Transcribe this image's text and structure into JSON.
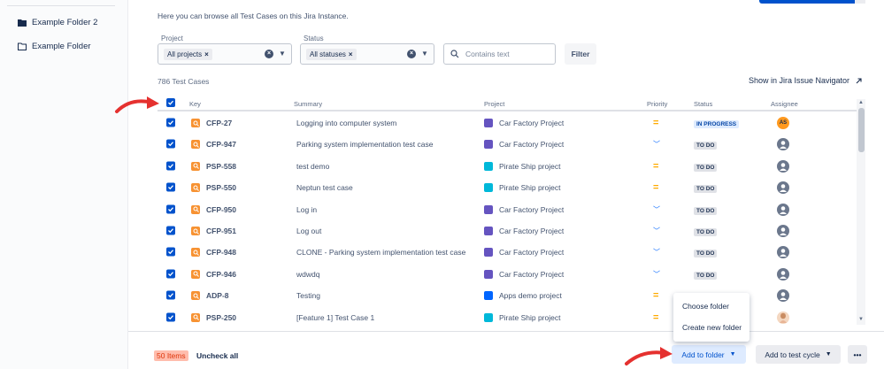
{
  "sidebar": {
    "folders": [
      {
        "label": "Example Folder 2",
        "icon": "folder-filled-icon"
      },
      {
        "label": "Example Folder",
        "icon": "folder-outline-icon"
      }
    ]
  },
  "intro": "Here you can browse all Test Cases on this Jira Instance.",
  "filters": {
    "project_label": "Project",
    "project_value": "All projects",
    "status_label": "Status",
    "status_value": "All statuses",
    "search_placeholder": "Contains text",
    "filter_button": "Filter"
  },
  "count_text": "786 Test Cases",
  "navigator_link": "Show in Jira Issue Navigator",
  "table": {
    "columns": [
      "Key",
      "Summary",
      "Project",
      "Priority",
      "Status",
      "Assignee"
    ],
    "rows": [
      {
        "key": "CFP-27",
        "summary": "Logging into computer system",
        "project": "Car Factory Project",
        "project_color": "#6554c0",
        "priority": "medium",
        "status": "IN PROGRESS",
        "assignee": "AS"
      },
      {
        "key": "CFP-947",
        "summary": "Parking system implementation test case",
        "project": "Car Factory Project",
        "project_color": "#6554c0",
        "priority": "low",
        "status": "TO DO",
        "assignee": ""
      },
      {
        "key": "PSP-558",
        "summary": "test demo",
        "project": "Pirate Ship project",
        "project_color": "#00b8d9",
        "priority": "medium",
        "status": "TO DO",
        "assignee": ""
      },
      {
        "key": "PSP-550",
        "summary": "Neptun test case",
        "project": "Pirate Ship project",
        "project_color": "#00b8d9",
        "priority": "medium",
        "status": "TO DO",
        "assignee": ""
      },
      {
        "key": "CFP-950",
        "summary": "Log in",
        "project": "Car Factory Project",
        "project_color": "#6554c0",
        "priority": "low",
        "status": "TO DO",
        "assignee": ""
      },
      {
        "key": "CFP-951",
        "summary": "Log out",
        "project": "Car Factory Project",
        "project_color": "#6554c0",
        "priority": "low",
        "status": "TO DO",
        "assignee": ""
      },
      {
        "key": "CFP-948",
        "summary": "CLONE - Parking system implementation test case",
        "project": "Car Factory Project",
        "project_color": "#6554c0",
        "priority": "low",
        "status": "TO DO",
        "assignee": ""
      },
      {
        "key": "CFP-946",
        "summary": "wdwdq",
        "project": "Car Factory Project",
        "project_color": "#6554c0",
        "priority": "low",
        "status": "TO DO",
        "assignee": ""
      },
      {
        "key": "ADP-8",
        "summary": "Testing",
        "project": "Apps demo project",
        "project_color": "#0065ff",
        "priority": "medium",
        "status": "",
        "assignee": ""
      },
      {
        "key": "PSP-250",
        "summary": "[Feature 1] Test Case 1",
        "project": "Pirate Ship project",
        "project_color": "#00b8d9",
        "priority": "medium",
        "status": "",
        "assignee": "photo"
      }
    ]
  },
  "bottom": {
    "items_badge": "50 Items",
    "uncheck_all": "Uncheck all",
    "add_to_folder": "Add to folder",
    "add_to_cycle": "Add to test cycle",
    "more": "•••"
  },
  "folder_menu": {
    "items": [
      "Choose folder",
      "Create new folder"
    ]
  },
  "colors": {
    "accent": "#0052cc",
    "annotation_arrow": "#e5312f"
  }
}
